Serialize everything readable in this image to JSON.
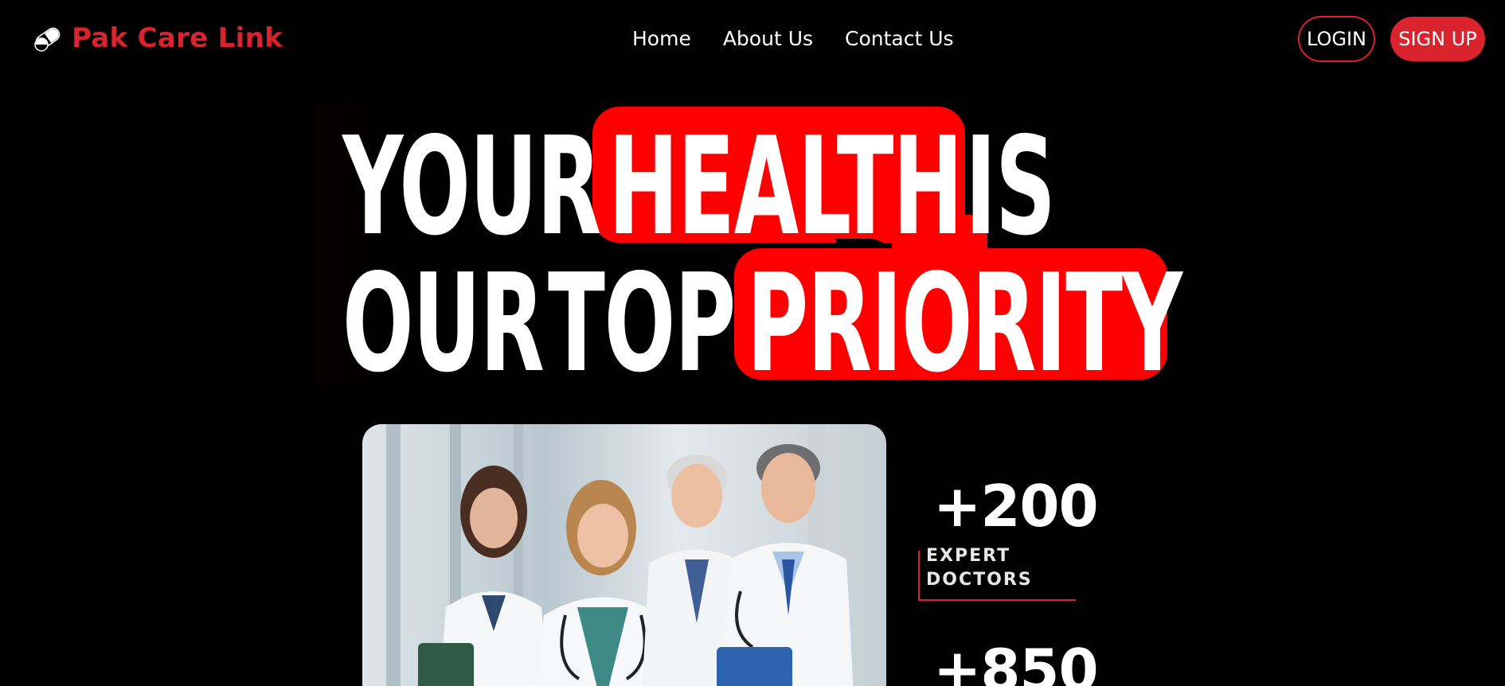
{
  "brand": {
    "name": "Pak Care Link",
    "logo_icon": "capsule-logo-icon",
    "color": "#d9232d"
  },
  "nav": {
    "items": [
      {
        "label": "Home"
      },
      {
        "label": "About Us"
      },
      {
        "label": "Contact Us"
      }
    ]
  },
  "auth": {
    "login_label": "LOGIN",
    "signup_label": "SIGN UP"
  },
  "hero": {
    "line1": [
      "YOUR",
      "HEALTH",
      "IS"
    ],
    "line2": [
      "OUR",
      "TOP",
      "PRIORITY"
    ],
    "highlight_color": "#ff0000"
  },
  "photo": {
    "icon": "doctors-team-photo"
  },
  "stats": [
    {
      "value": "+200",
      "label_line1": "EXPERT",
      "label_line2": "DOCTORS"
    },
    {
      "value": "+850"
    }
  ],
  "colors": {
    "background": "#000000",
    "accent": "#d9232d"
  }
}
